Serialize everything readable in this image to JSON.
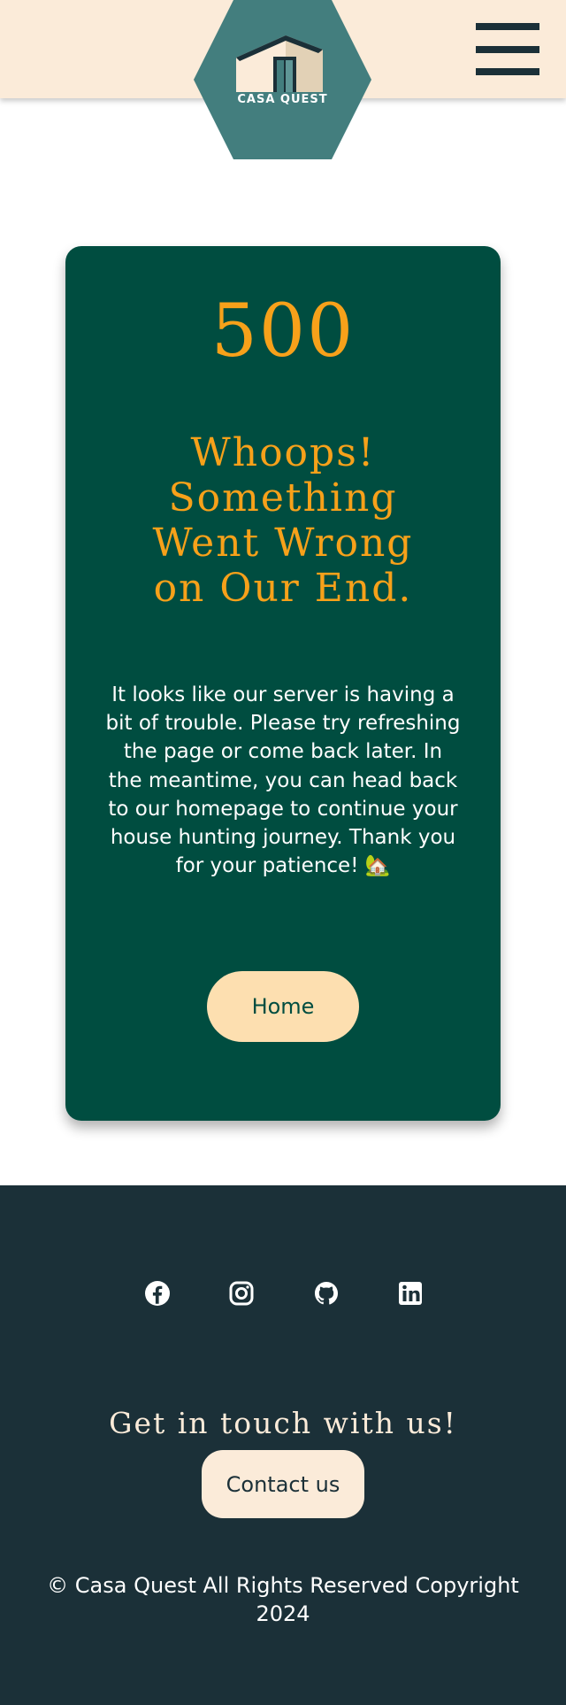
{
  "header": {
    "logo_text": "CASA QUEST",
    "menu_icon": "hamburger-menu-icon"
  },
  "error": {
    "code": "500",
    "headline": "Whoops! Something Went Wrong on Our End.",
    "message": "It looks like our server is having a bit of trouble. Please try refreshing the page or come back later. In the meantime, you can head back to our homepage to continue your house hunting journey. Thank you for your patience! 🏡",
    "home_button": "Home"
  },
  "footer": {
    "social_icons": [
      "facebook-icon",
      "instagram-icon",
      "github-icon",
      "linkedin-icon"
    ],
    "title": "Get in touch with us!",
    "contact_button": "Contact us",
    "copyright": "© Casa Quest All Rights Reserved Copyright 2024"
  },
  "colors": {
    "header_bg": "#fbebd9",
    "logo_hex": "#437e7e",
    "card_bg": "#004d40",
    "accent_orange": "#f7a11a",
    "home_button_bg": "#fddfb0",
    "footer_bg": "#1b3038",
    "contact_button_bg": "#fbebd9"
  }
}
